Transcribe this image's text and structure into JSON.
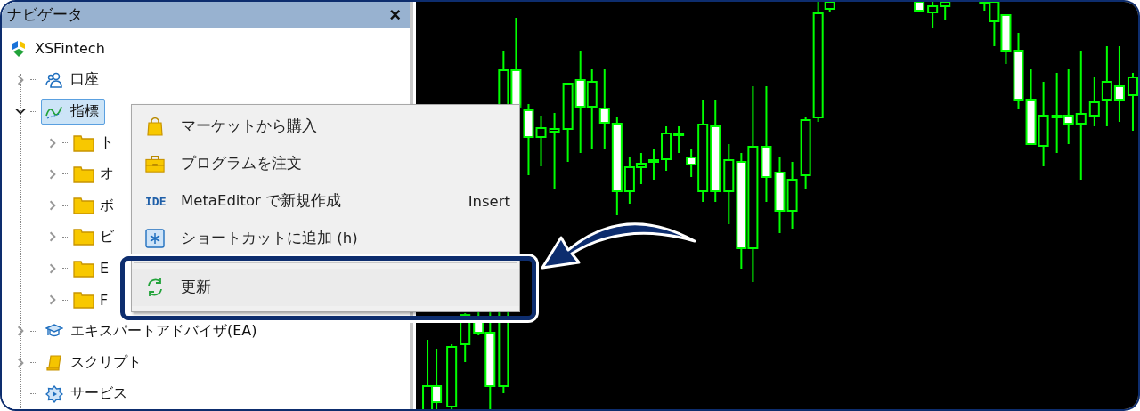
{
  "navigator": {
    "title": "ナビゲータ",
    "close": "×",
    "root": {
      "label": "XSFintech"
    },
    "items": [
      {
        "kind": "account",
        "label": "口座",
        "expanded": false,
        "selected": false
      },
      {
        "kind": "indicator",
        "label": "指標",
        "expanded": true,
        "selected": true,
        "children": [
          {
            "label": "ト"
          },
          {
            "label": "オ"
          },
          {
            "label": "ボ"
          },
          {
            "label": "ビ"
          },
          {
            "label": "E"
          },
          {
            "label": "F"
          }
        ]
      },
      {
        "kind": "expert",
        "label": "エキスパートアドバイザ(EA)",
        "expanded": false,
        "selected": false
      },
      {
        "kind": "script",
        "label": "スクリプト",
        "expanded": false,
        "selected": false
      },
      {
        "kind": "service",
        "label": "サービス",
        "selected": false
      }
    ]
  },
  "context_menu": {
    "items": [
      {
        "kind": "market",
        "label": "マーケットから購入",
        "highlighted": false
      },
      {
        "kind": "order",
        "label": "プログラムを注文",
        "highlighted": false
      },
      {
        "kind": "ide",
        "icon_text": "IDE",
        "label": "MetaEditor で新規作成",
        "shortcut": "Insert",
        "highlighted": false
      },
      {
        "kind": "shortcut",
        "label": "ショートカットに追加 (h)",
        "highlighted": false
      },
      {
        "kind": "separator"
      },
      {
        "kind": "refresh",
        "label": "更新",
        "highlighted": true
      }
    ]
  }
}
